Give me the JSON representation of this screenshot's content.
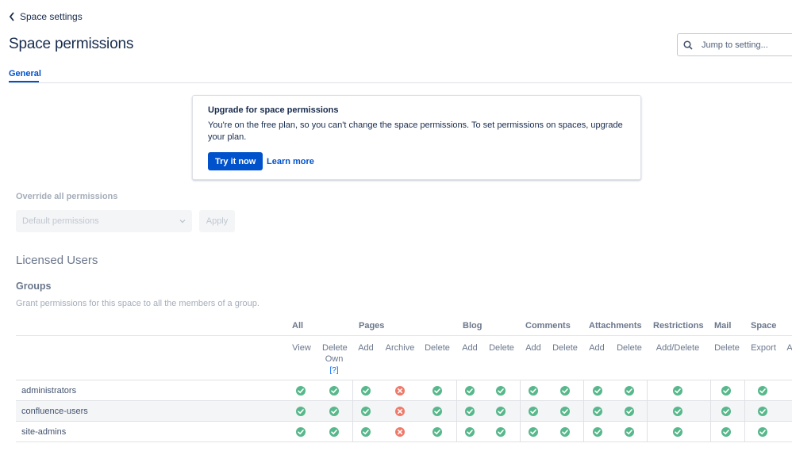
{
  "nav": {
    "back_label": "Space settings"
  },
  "page": {
    "title": "Space permissions"
  },
  "search": {
    "placeholder": "Jump to setting..."
  },
  "tabs": [
    {
      "label": "General",
      "active": true
    }
  ],
  "upgrade": {
    "title": "Upgrade for space permissions",
    "body": "You're on the free plan, so you can't change the space permissions. To set permissions on spaces, upgrade your plan.",
    "primary_label": "Try it now",
    "secondary_label": "Learn more"
  },
  "override": {
    "label": "Override all permissions",
    "select_value": "Default permissions",
    "apply_label": "Apply"
  },
  "licensed_users": {
    "heading": "Licensed Users"
  },
  "groups": {
    "heading": "Groups",
    "description": "Grant permissions for this space to all the members of a group.",
    "categories": [
      "All",
      "Pages",
      "Blog",
      "Comments",
      "Attachments",
      "Restrictions",
      "Mail",
      "Space"
    ],
    "columns": [
      "View",
      "Delete Own",
      "Add",
      "Archive",
      "Delete",
      "Add",
      "Delete",
      "Add",
      "Delete",
      "Add",
      "Delete",
      "Add/Delete",
      "Delete",
      "Export",
      "A"
    ],
    "help_link": "[?]",
    "rows": [
      {
        "name": "administrators",
        "permissions": [
          true,
          true,
          true,
          false,
          true,
          true,
          true,
          true,
          true,
          true,
          true,
          true,
          true,
          true
        ]
      },
      {
        "name": "confluence-users",
        "permissions": [
          true,
          true,
          true,
          false,
          true,
          true,
          true,
          true,
          true,
          true,
          true,
          true,
          true,
          true
        ]
      },
      {
        "name": "site-admins",
        "permissions": [
          true,
          true,
          true,
          false,
          true,
          true,
          true,
          true,
          true,
          true,
          true,
          true,
          true,
          true
        ]
      }
    ]
  },
  "colors": {
    "primary": "#0052cc",
    "granted": "#57b88b",
    "denied": "#f07a6a",
    "text": "#172b4d",
    "muted": "#6b778c"
  }
}
